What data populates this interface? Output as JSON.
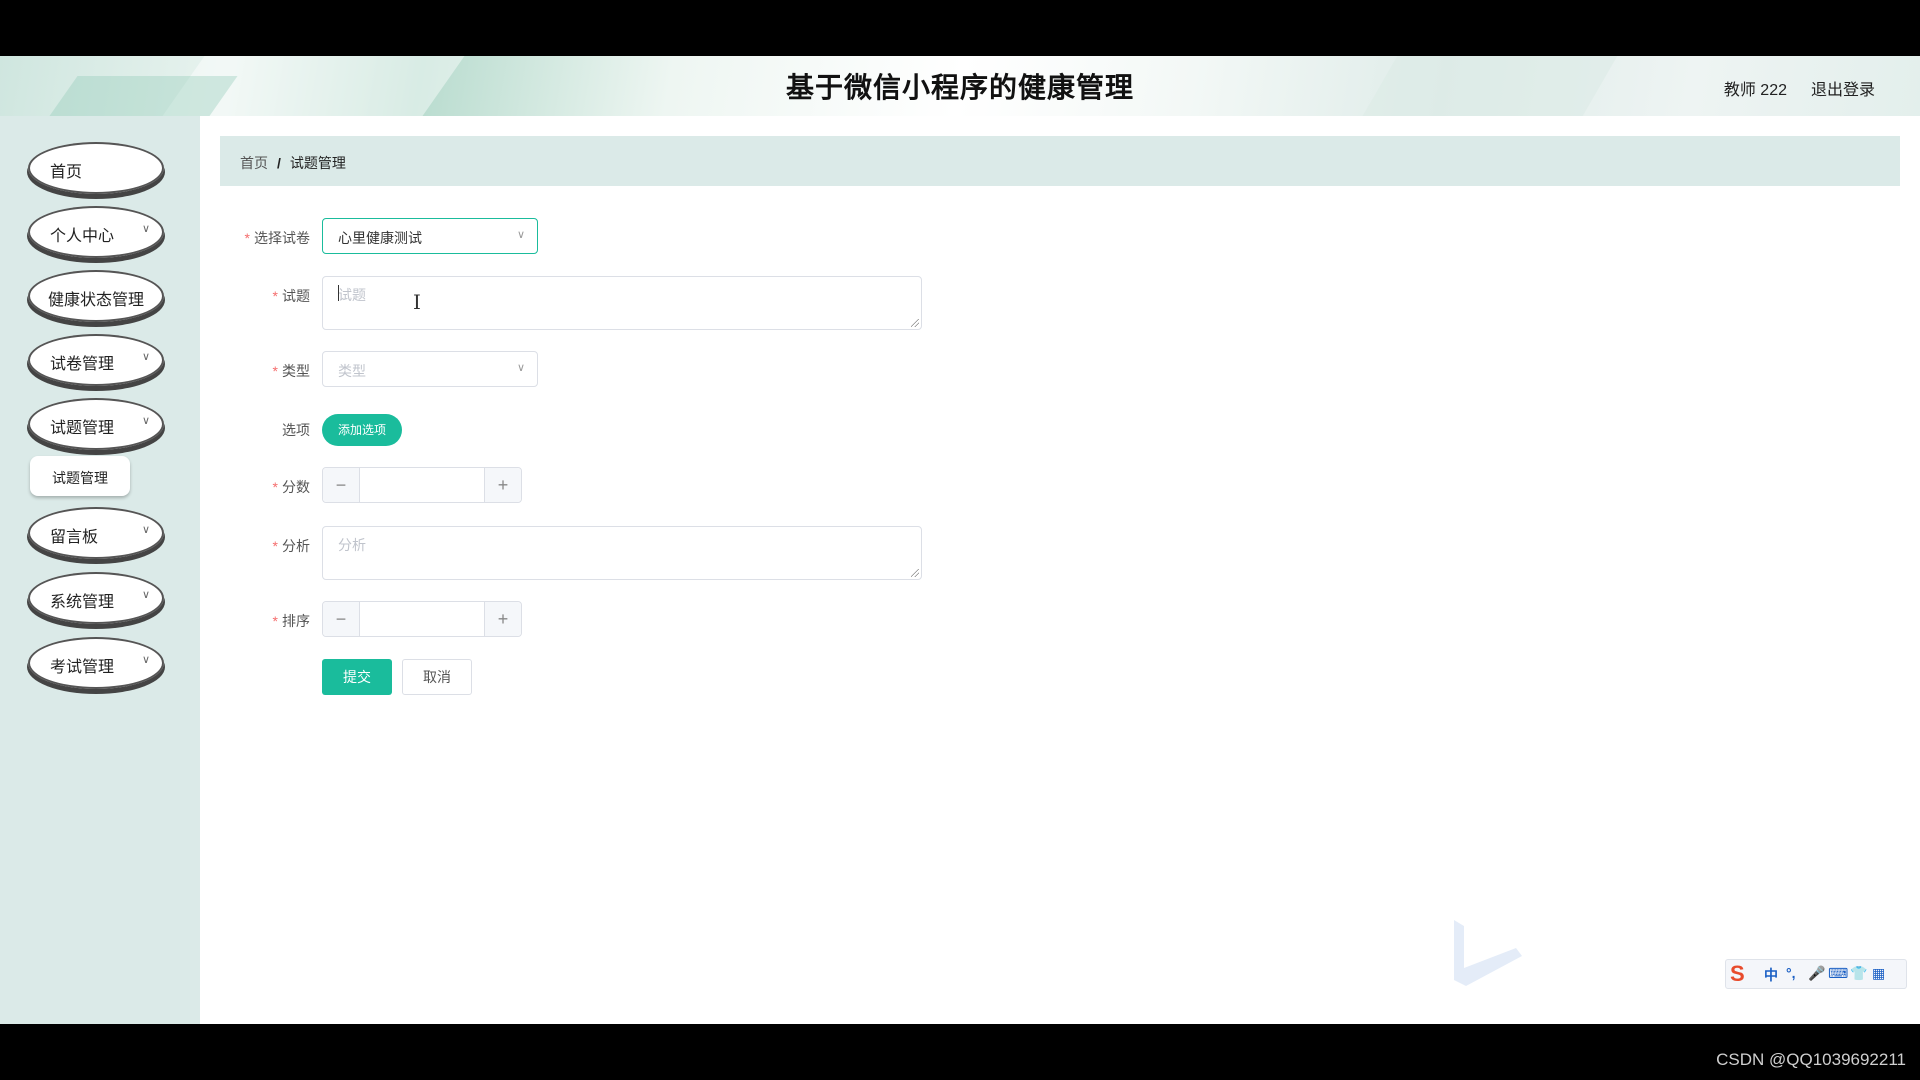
{
  "header": {
    "title": "基于微信小程序的健康管理",
    "user": "教师 222",
    "logout": "退出登录"
  },
  "sidebar": {
    "items": [
      {
        "label": "首页",
        "expandable": false
      },
      {
        "label": "个人中心",
        "expandable": true
      },
      {
        "label": "健康状态管理",
        "expandable": false
      },
      {
        "label": "试卷管理",
        "expandable": true
      },
      {
        "label": "试题管理",
        "expandable": true
      },
      {
        "label": "留言板",
        "expandable": true
      },
      {
        "label": "系统管理",
        "expandable": true
      },
      {
        "label": "考试管理",
        "expandable": true
      }
    ],
    "sub_item": "试题管理",
    "chevron": "∨"
  },
  "breadcrumb": {
    "home": "首页",
    "separator": "/",
    "current": "试题管理"
  },
  "form": {
    "required_mark": "*",
    "paper": {
      "label": "选择试卷",
      "value": "心里健康测试"
    },
    "question": {
      "label": "试题",
      "placeholder": "试题"
    },
    "type": {
      "label": "类型",
      "placeholder": "类型"
    },
    "options": {
      "label": "选项",
      "button": "添加选项"
    },
    "score": {
      "label": "分数",
      "minus": "−",
      "plus": "+"
    },
    "analysis": {
      "label": "分析",
      "placeholder": "分析"
    },
    "order": {
      "label": "排序",
      "minus": "−",
      "plus": "+"
    },
    "submit": "提交",
    "cancel": "取消"
  },
  "ime": {
    "logo": "S",
    "zh": "中",
    "punc": "°,",
    "mic": "🎤",
    "kbd": "⌨",
    "skin": "👕",
    "grid": "▦"
  },
  "watermark": "CSDN @QQ1039692211",
  "colors": {
    "accent": "#1abc9c",
    "sidebar_bg": "#dbeae8",
    "required": "#f56c6c"
  }
}
